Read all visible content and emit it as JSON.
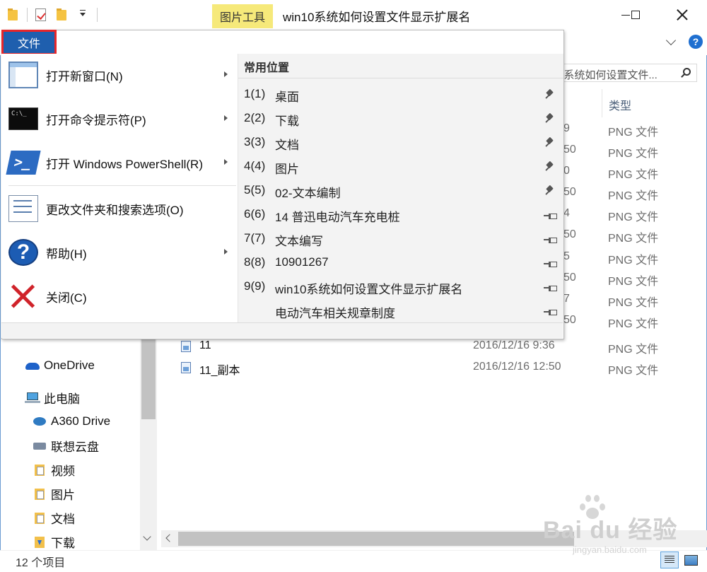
{
  "window": {
    "title": "win10系统如何设置文件显示扩展名",
    "context_tab": "图片工具"
  },
  "search": {
    "value": "0系统如何设置文件..."
  },
  "list": {
    "column_type": "类型",
    "partial_dates": [
      "9",
      "50",
      "0",
      "50",
      "4",
      "50",
      "5",
      "50",
      "7",
      "50"
    ],
    "partial_types": [
      "PNG 文件",
      "PNG 文件",
      "PNG 文件",
      "PNG 文件",
      "PNG 文件",
      "PNG 文件",
      "PNG 文件",
      "PNG 文件",
      "PNG 文件",
      "PNG 文件"
    ],
    "files": [
      {
        "name": "11",
        "date": "2016/12/16 9:36",
        "type": "PNG 文件"
      },
      {
        "name": "11_副本",
        "date": "2016/12/16 12:50",
        "type": "PNG 文件"
      }
    ]
  },
  "nav": {
    "items": [
      {
        "label": "OneDrive",
        "icon": "onedrive-icon"
      },
      {
        "label": "此电脑",
        "icon": "computer-icon"
      },
      {
        "label": "A360 Drive",
        "icon": "a360-drive-icon"
      },
      {
        "label": "联想云盘",
        "icon": "cloud-disk-icon"
      },
      {
        "label": "视频",
        "icon": "videos-folder-icon"
      },
      {
        "label": "图片",
        "icon": "pictures-folder-icon"
      },
      {
        "label": "文档",
        "icon": "documents-folder-icon"
      },
      {
        "label": "下载",
        "icon": "downloads-folder-icon"
      }
    ]
  },
  "status": {
    "count": "12 个项目"
  },
  "file_menu": {
    "tab_label": "文件",
    "left_items": [
      {
        "label": "打开新窗口(N)",
        "icon": "new-window-icon",
        "submenu": true
      },
      {
        "label": "打开命令提示符(P)",
        "icon": "command-prompt-icon",
        "submenu": true
      },
      {
        "label": "打开 Windows PowerShell(R)",
        "icon": "powershell-icon",
        "submenu": true
      },
      {
        "label": "更改文件夹和搜索选项(O)",
        "icon": "folder-options-icon",
        "submenu": false
      },
      {
        "label": "帮助(H)",
        "icon": "help-icon",
        "submenu": true
      },
      {
        "label": "关闭(C)",
        "icon": "close-icon",
        "submenu": false
      }
    ],
    "frequent_title": "常用位置",
    "frequent_places": [
      {
        "num": "1(1)",
        "name": "桌面",
        "pinned": true
      },
      {
        "num": "2(2)",
        "name": "下载",
        "pinned": true
      },
      {
        "num": "3(3)",
        "name": "文档",
        "pinned": true
      },
      {
        "num": "4(4)",
        "name": "图片",
        "pinned": true
      },
      {
        "num": "5(5)",
        "name": "02-文本编制",
        "pinned": true
      },
      {
        "num": "6(6)",
        "name": "14 普迅电动汽车充电桩",
        "pinned": false
      },
      {
        "num": "7(7)",
        "name": "文本编写",
        "pinned": false
      },
      {
        "num": "8(8)",
        "name": "10901267",
        "pinned": false
      },
      {
        "num": "9(9)",
        "name": "win10系统如何设置文件显示扩展名",
        "pinned": false
      },
      {
        "num": "",
        "name": "电动汽车相关规章制度",
        "pinned": false
      }
    ]
  },
  "watermark": {
    "brand": "Bai du 经验",
    "url": "jingyan.baidu.com"
  }
}
